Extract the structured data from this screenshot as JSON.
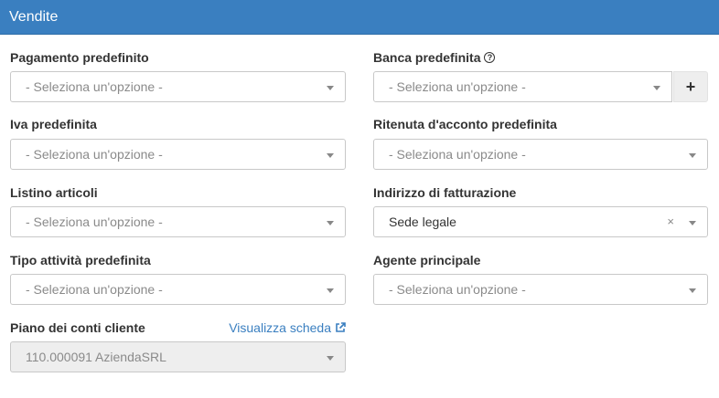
{
  "header": {
    "title": "Vendite"
  },
  "fields": {
    "pagamento": {
      "label": "Pagamento predefinito",
      "placeholder": "- Seleziona un'opzione -"
    },
    "banca": {
      "label": "Banca predefinita",
      "placeholder": "- Seleziona un'opzione -",
      "add_label": "+"
    },
    "iva": {
      "label": "Iva predefinita",
      "placeholder": "- Seleziona un'opzione -"
    },
    "ritenuta": {
      "label": "Ritenuta d'acconto predefinita",
      "placeholder": "- Seleziona un'opzione -"
    },
    "listino": {
      "label": "Listino articoli",
      "placeholder": "- Seleziona un'opzione -"
    },
    "indirizzo": {
      "label": "Indirizzo di fatturazione",
      "value": "Sede legale",
      "clear_label": "×"
    },
    "tipo_attivita": {
      "label": "Tipo attività predefinita",
      "placeholder": "- Seleziona un'opzione -"
    },
    "agente": {
      "label": "Agente principale",
      "placeholder": "- Seleziona un'opzione -"
    },
    "piano_conti": {
      "label": "Piano dei conti cliente",
      "link": "Visualizza scheda",
      "value": "110.000091 AziendaSRL"
    }
  },
  "icons": {
    "help": "question-circle-icon",
    "external": "external-link-icon",
    "caret": "chevron-down-icon",
    "add": "plus-icon",
    "clear": "close-icon"
  },
  "colors": {
    "header_bg": "#3a7fc0",
    "link": "#3a7fc0"
  }
}
